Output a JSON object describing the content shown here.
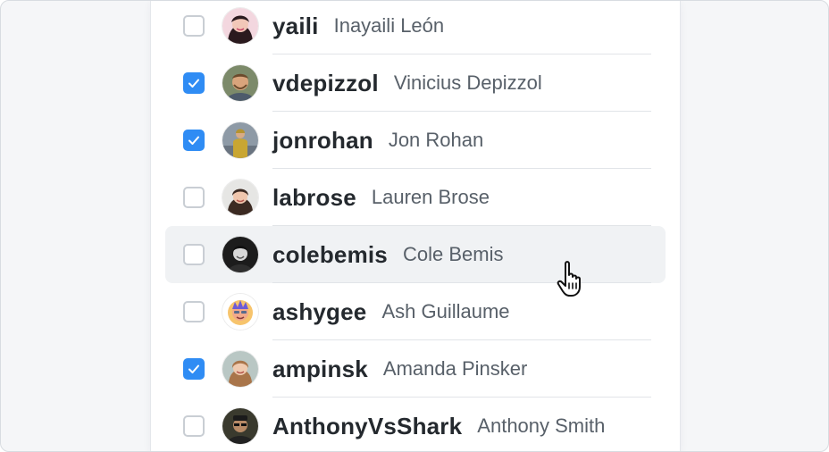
{
  "users": [
    {
      "login": "yaili",
      "name": "Inayaili León",
      "checked": false,
      "avatar": "avatar-yaili",
      "hovered": false
    },
    {
      "login": "vdepizzol",
      "name": "Vinicius Depizzol",
      "checked": true,
      "avatar": "avatar-vdepizzol",
      "hovered": false
    },
    {
      "login": "jonrohan",
      "name": "Jon Rohan",
      "checked": true,
      "avatar": "avatar-jonrohan",
      "hovered": false
    },
    {
      "login": "labrose",
      "name": "Lauren Brose",
      "checked": false,
      "avatar": "avatar-labrose",
      "hovered": false
    },
    {
      "login": "colebemis",
      "name": "Cole Bemis",
      "checked": false,
      "avatar": "avatar-colebemis",
      "hovered": true
    },
    {
      "login": "ashygee",
      "name": "Ash Guillaume",
      "checked": false,
      "avatar": "avatar-ashygee",
      "hovered": false
    },
    {
      "login": "ampinsk",
      "name": "Amanda Pinsker",
      "checked": true,
      "avatar": "avatar-ampinsk",
      "hovered": false
    },
    {
      "login": "AnthonyVsShark",
      "name": "Anthony Smith",
      "checked": false,
      "avatar": "avatar-anthonyvsshark",
      "hovered": false
    }
  ],
  "colors": {
    "accent": "#2f8cf4",
    "hover_bg": "#f0f2f4",
    "login_text": "#24292e",
    "name_text": "#586069"
  },
  "cursor_icon": "hand-pointer-icon"
}
